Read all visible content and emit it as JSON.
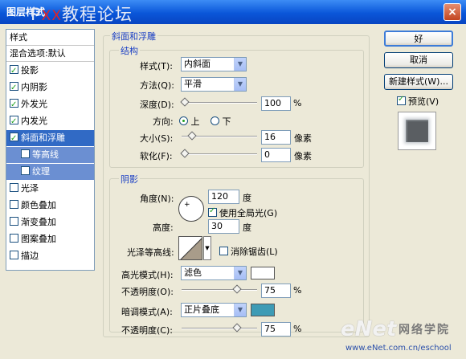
{
  "window": {
    "title": "图层样式",
    "watermark_prefix": "P",
    "watermark_text": "教程论坛",
    "watermark_red": "XX",
    "close_label": "×"
  },
  "sidebar": {
    "items": [
      {
        "label": "样式",
        "checkbox": false
      },
      {
        "label": "混合选项:默认",
        "checkbox": false
      },
      {
        "label": "投影",
        "checkbox": true,
        "checked": true
      },
      {
        "label": "内阴影",
        "checkbox": true,
        "checked": true
      },
      {
        "label": "外发光",
        "checkbox": true,
        "checked": true
      },
      {
        "label": "内发光",
        "checkbox": true,
        "checked": true
      },
      {
        "label": "斜面和浮雕",
        "checkbox": true,
        "checked": true,
        "selected": true
      },
      {
        "label": "等高线",
        "checkbox": true,
        "checked": false,
        "sub": true
      },
      {
        "label": "纹理",
        "checkbox": true,
        "checked": false,
        "sub": true
      },
      {
        "label": "光泽",
        "checkbox": true,
        "checked": false
      },
      {
        "label": "颜色叠加",
        "checkbox": true,
        "checked": false
      },
      {
        "label": "渐变叠加",
        "checkbox": true,
        "checked": false
      },
      {
        "label": "图案叠加",
        "checkbox": true,
        "checked": false
      },
      {
        "label": "描边",
        "checkbox": true,
        "checked": false
      }
    ]
  },
  "bevel": {
    "group_title": "斜面和浮雕",
    "structure": {
      "group_title": "结构",
      "style_label": "样式(T):",
      "style_value": "内斜面",
      "method_label": "方法(Q):",
      "method_value": "平滑",
      "depth_label": "深度(D):",
      "depth_value": "100",
      "depth_unit": "%",
      "direction_label": "方向:",
      "direction_up": "上",
      "direction_down": "下",
      "size_label": "大小(S):",
      "size_value": "16",
      "size_unit": "像素",
      "soften_label": "软化(F):",
      "soften_value": "0",
      "soften_unit": "像素"
    },
    "shading": {
      "group_title": "阴影",
      "angle_label": "角度(N):",
      "angle_value": "120",
      "angle_unit": "度",
      "global_light_label": "使用全局光(G)",
      "global_light_checked": true,
      "altitude_label": "高度:",
      "altitude_value": "30",
      "altitude_unit": "度",
      "gloss_contour_label": "光泽等高线:",
      "anti_alias_label": "消除锯齿(L)",
      "anti_alias_checked": false,
      "highlight_mode_label": "高光模式(H):",
      "highlight_mode_value": "滤色",
      "highlight_color": "#FFFFFF",
      "highlight_opacity_label": "不透明度(O):",
      "highlight_opacity_value": "75",
      "highlight_opacity_unit": "%",
      "shadow_mode_label": "暗调模式(A):",
      "shadow_mode_value": "正片叠底",
      "shadow_color": "#3E9BB5",
      "shadow_opacity_label": "不透明度(C):",
      "shadow_opacity_value": "75",
      "shadow_opacity_unit": "%"
    },
    "slider_levels": {
      "depth": 0.0,
      "size": 0.1,
      "soften": 0.0,
      "highlight_opacity": 0.75,
      "shadow_opacity": 0.75
    }
  },
  "buttons": {
    "ok_label": "好",
    "cancel_label": "取消",
    "new_style_label": "新建样式(W)...",
    "preview_label": "预览(V)",
    "preview_checked": true
  },
  "watermark_bottom": {
    "chars": "网络学院",
    "logo": "eNet",
    "url": "www.eNet.com.cn/eschool"
  }
}
